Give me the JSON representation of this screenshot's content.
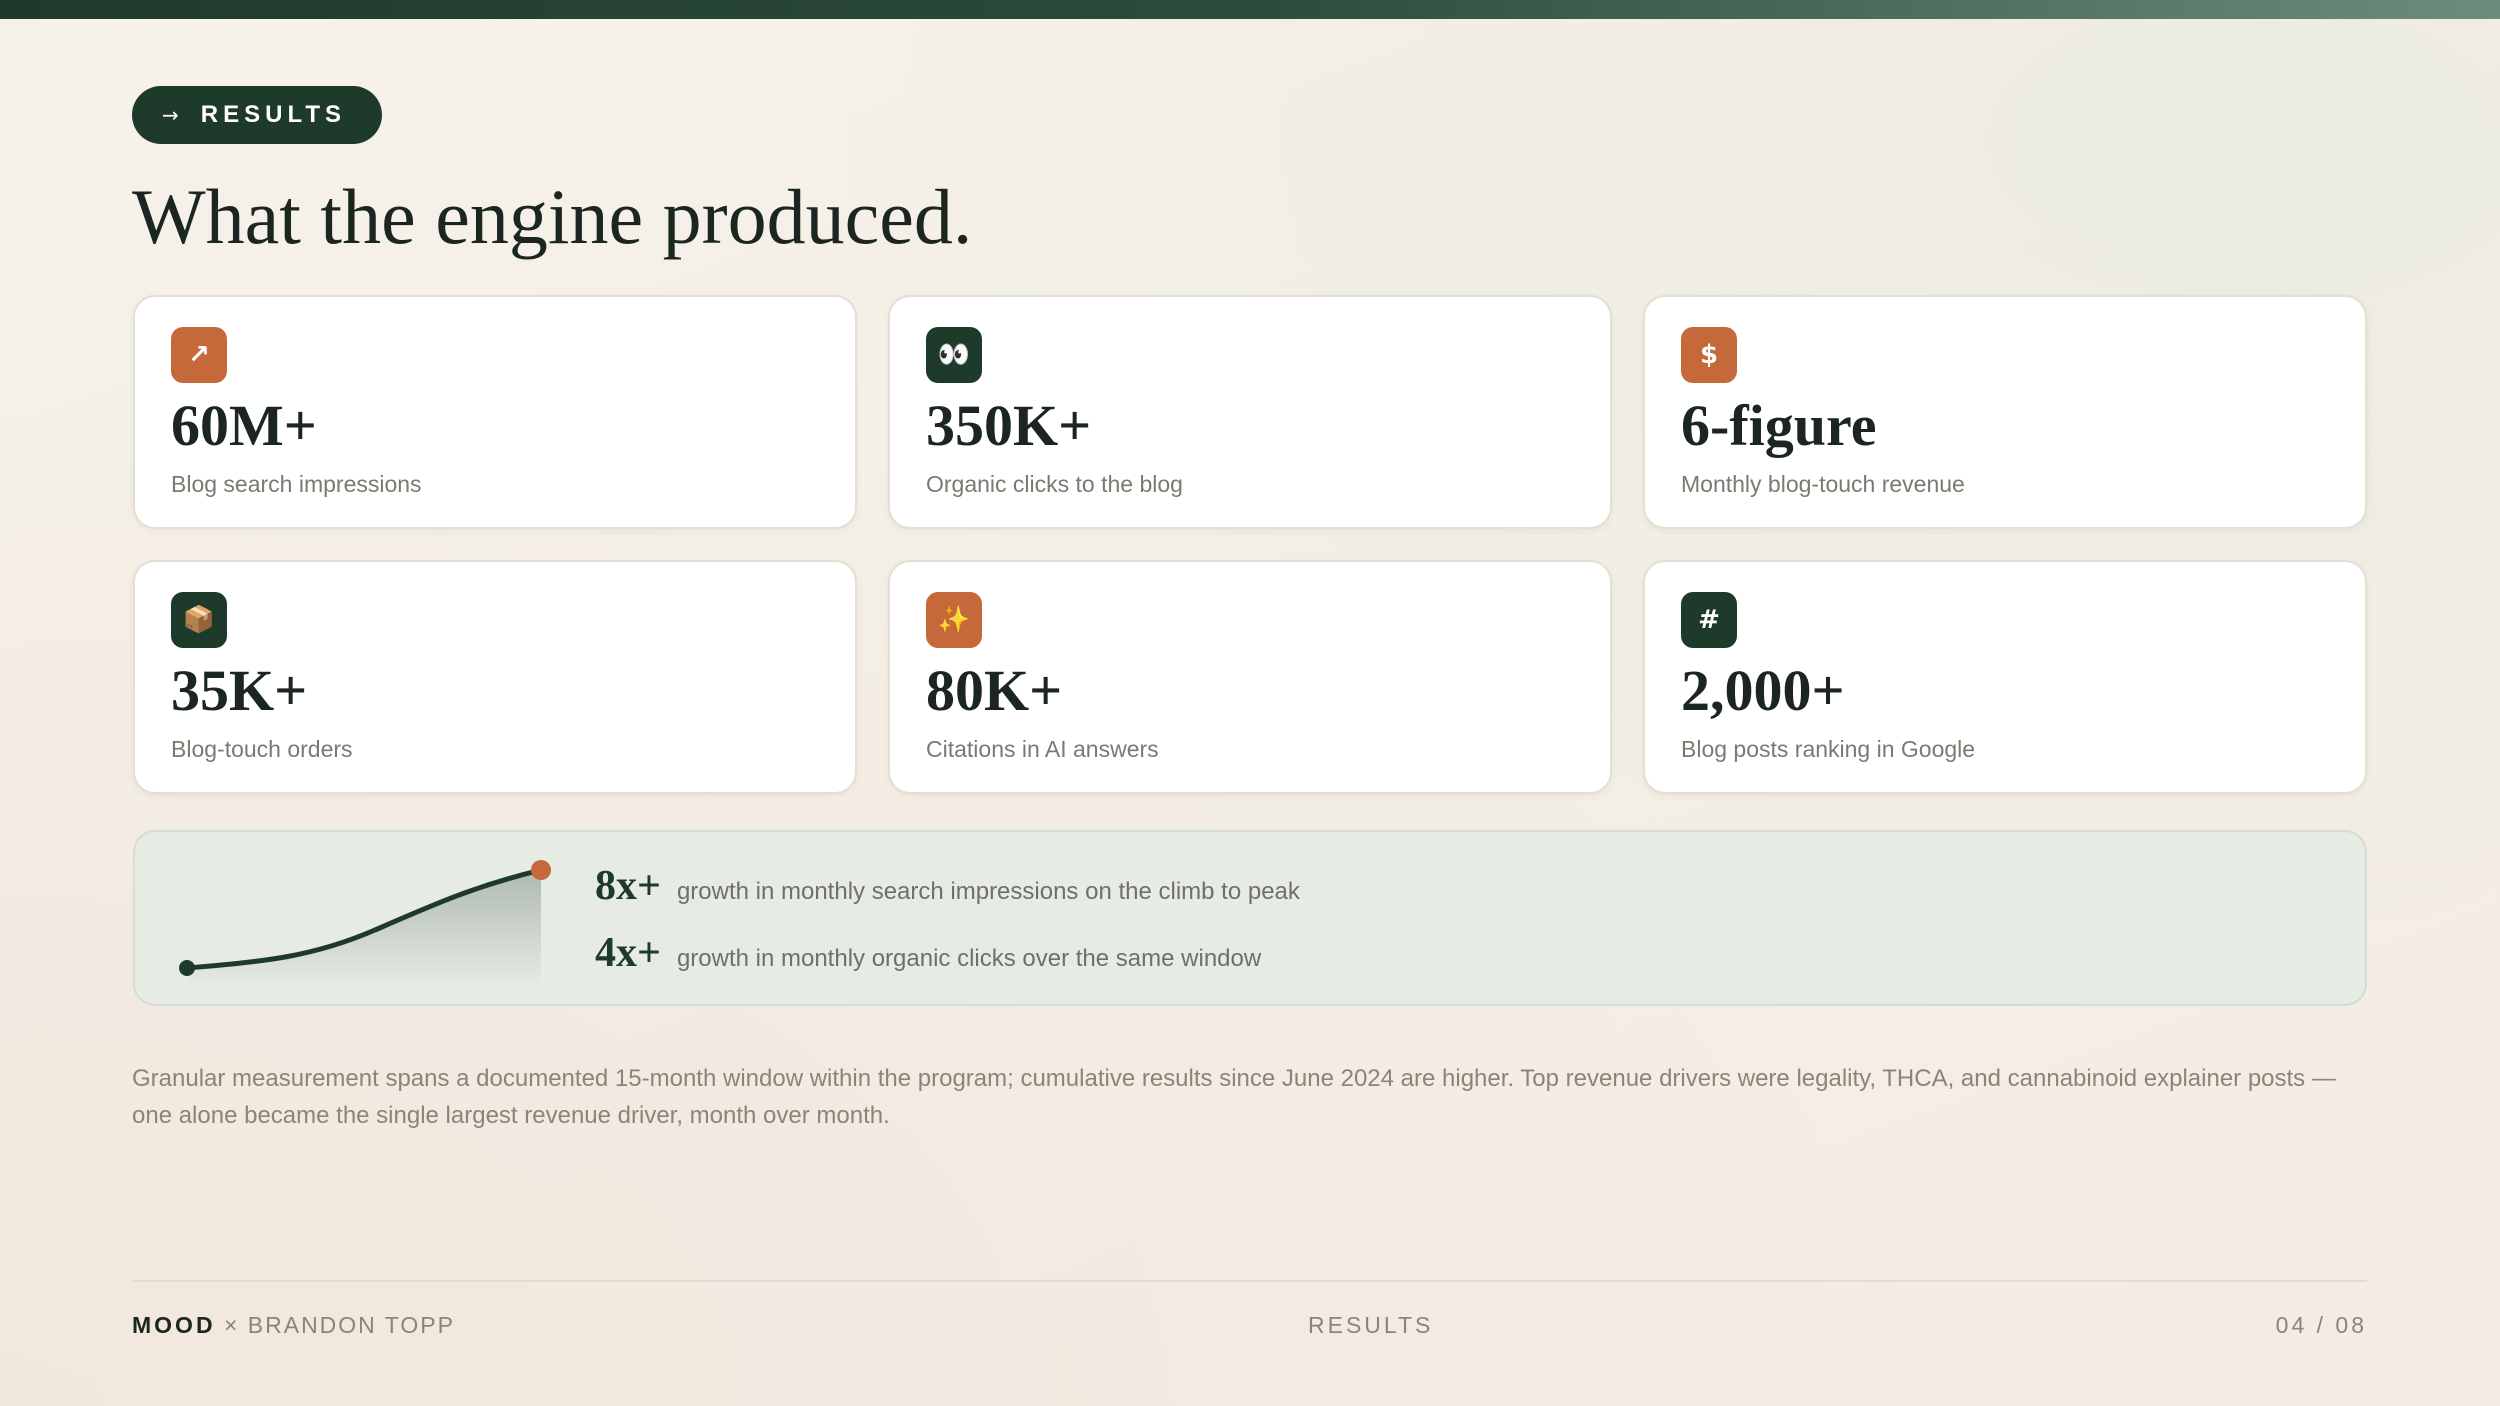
{
  "header": {
    "pill_arrow": "→",
    "pill_label": "RESULTS",
    "title": "What the engine produced."
  },
  "cards": [
    {
      "icon": "arrow-up-right-icon",
      "glyph": "↗",
      "color": "#c5683a",
      "value": "60M+",
      "label": "Blog search impressions"
    },
    {
      "icon": "eyes-icon",
      "glyph": "👀",
      "color": "#1e3a2b",
      "value": "350K+",
      "label": "Organic clicks to the blog"
    },
    {
      "icon": "dollar-icon",
      "glyph": "$",
      "color": "#c5683a",
      "value": "6-figure",
      "label": "Monthly blog-touch revenue"
    },
    {
      "icon": "package-icon",
      "glyph": "📦",
      "color": "#1e3a2b",
      "value": "35K+",
      "label": "Blog-touch orders"
    },
    {
      "icon": "sparkles-icon",
      "glyph": "✨",
      "color": "#c5683a",
      "value": "80K+",
      "label": "Citations in AI answers"
    },
    {
      "icon": "hash-icon",
      "glyph": "#",
      "color": "#1e3a2b",
      "value": "2,000+",
      "label": "Blog posts ranking in Google"
    }
  ],
  "growth": {
    "rows": [
      {
        "value": "8x+",
        "text": "growth in monthly search impressions on the climb to peak"
      },
      {
        "value": "4x+",
        "text": "growth in monthly organic clicks over the same window"
      }
    ]
  },
  "footnote": "Granular measurement spans a documented 15-month window within the program; cumulative results since June 2024 are higher. Top revenue drivers were legality, THCA, and cannabinoid explainer posts — one alone became the single largest revenue driver, month over month.",
  "footer": {
    "brand": "MOOD",
    "separator": " × ",
    "partner": "BRANDON TOPP",
    "section": "RESULTS",
    "page": "04 / 08"
  },
  "colors": {
    "accent_green": "#1e3a2b",
    "accent_orange": "#c5683a"
  }
}
